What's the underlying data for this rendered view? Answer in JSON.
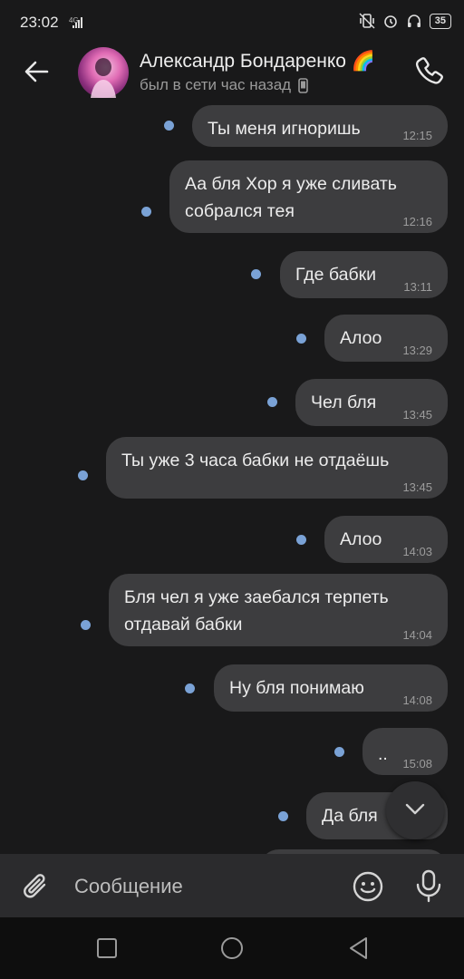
{
  "status_bar": {
    "time": "23:02",
    "network": "4G",
    "battery": "35"
  },
  "header": {
    "contact_name": "Александр Бондаренко",
    "flag_emoji": "🌈",
    "last_seen": "был в сети час назад",
    "icons": [
      "arrow-back-icon",
      "phone-icon",
      "mobile-device-icon"
    ]
  },
  "messages": [
    {
      "text": "Ты меня игноришь",
      "time": "12:15"
    },
    {
      "text": "Аа бля Хор я уже сливать\nсобрался тея",
      "time": "12:16"
    },
    {
      "text": "Где бабки",
      "time": "13:11"
    },
    {
      "text": "Алоо",
      "time": "13:29"
    },
    {
      "text": "Чел бля",
      "time": "13:45"
    },
    {
      "text": "Ты уже 3 часа бабки не отдаёшь",
      "time": "13:45"
    },
    {
      "text": "Алоо",
      "time": "14:03"
    },
    {
      "text": "Бля чел я уже заебался терпеть\nотдавай бабки",
      "time": "14:04"
    },
    {
      "text": "Ну бля понимаю",
      "time": "14:08"
    },
    {
      "text": "..",
      "time": "15:08"
    },
    {
      "text": "Да бля",
      "time": ""
    }
  ],
  "composer": {
    "placeholder": "Сообщение"
  },
  "colors": {
    "background": "#19191a",
    "bubble": "#3d3d3f",
    "unread_dot": "#7aa2d6",
    "composer": "#2b2b2d"
  }
}
